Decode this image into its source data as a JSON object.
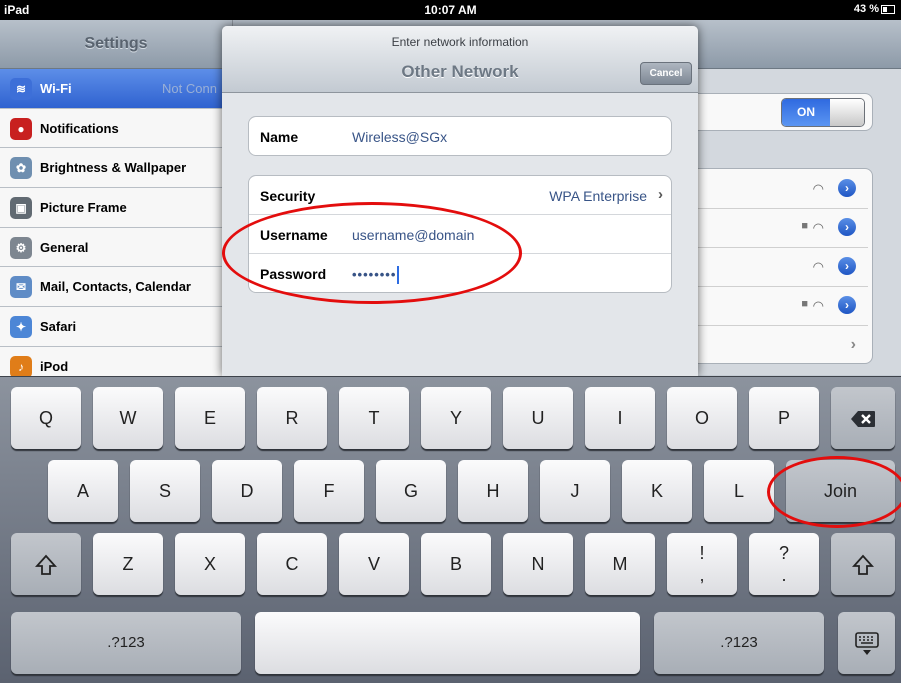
{
  "status_bar": {
    "device": "iPad",
    "time": "10:07 AM",
    "battery": "43 %"
  },
  "settings": {
    "title": "Settings",
    "items": [
      {
        "label": "Wi-Fi",
        "value": "Not Conn",
        "icon": "wifi-icon",
        "color": "#2e5fcd"
      },
      {
        "label": "Notifications",
        "icon": "notifications-icon",
        "color": "#c8201f"
      },
      {
        "label": "Brightness & Wallpaper",
        "icon": "flower-icon",
        "color": "#6f8fb0"
      },
      {
        "label": "Picture Frame",
        "icon": "picture-frame-icon",
        "color": "#616a72"
      },
      {
        "label": "General",
        "icon": "gear-icon",
        "color": "#7d8690"
      },
      {
        "label": "Mail, Contacts, Calendar",
        "icon": "mail-icon",
        "color": "#5f8cc6"
      },
      {
        "label": "Safari",
        "icon": "compass-icon",
        "color": "#4c86d6"
      },
      {
        "label": "iPod",
        "icon": "ipod-icon",
        "color": "#e07d19"
      }
    ]
  },
  "wifi_detail": {
    "toggle_label": "ON"
  },
  "modal": {
    "prompt": "Enter network information",
    "title": "Other Network",
    "cancel_label": "Cancel",
    "name_label": "Name",
    "name_value": "Wireless@SGx",
    "security_label": "Security",
    "security_value": "WPA Enterprise",
    "username_label": "Username",
    "username_value": "username@domain",
    "password_label": "Password",
    "password_value": "••••••••"
  },
  "keyboard": {
    "row1": [
      "Q",
      "W",
      "E",
      "R",
      "T",
      "Y",
      "U",
      "I",
      "O",
      "P"
    ],
    "row2": [
      "A",
      "S",
      "D",
      "F",
      "G",
      "H",
      "J",
      "K",
      "L"
    ],
    "row3": [
      "Z",
      "X",
      "C",
      "V",
      "B",
      "N",
      "M"
    ],
    "punct1": [
      "!",
      ","
    ],
    "punct2": [
      "?",
      "."
    ],
    "join_label": "Join",
    "numbers_label": ".?123"
  }
}
